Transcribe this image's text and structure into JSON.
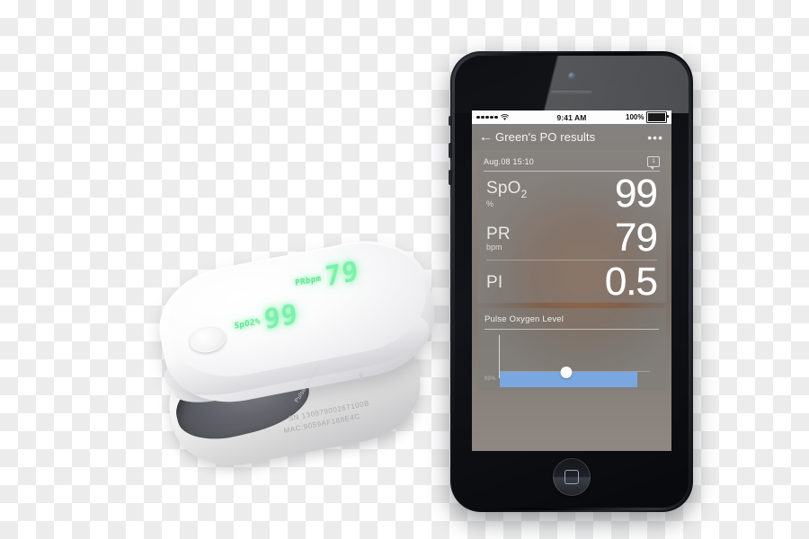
{
  "device": {
    "name": "pulse-oximeter",
    "led_display": {
      "spo2_label": "SpO2%",
      "spo2_value": "99",
      "pr_label": "PRbpm",
      "pr_value": "79"
    },
    "engraving": {
      "serial": "SN  13097900267100B",
      "mac": "MAC:9059AF188E4C",
      "fine_print": "Pulse Oximeter",
      "bluetooth_mark": "␢"
    }
  },
  "phone": {
    "status_bar": {
      "signal_dots": 5,
      "wifi_icon": "wifi-icon",
      "time": "9:41 AM",
      "battery_percent": "100%",
      "battery_icon": "battery-full-icon"
    },
    "nav_bar": {
      "back_icon": "←",
      "title": "Green's PO results",
      "more_icon": "•••"
    },
    "results_card": {
      "date": "Aug.08 15:10",
      "note_badge": "1",
      "note_icon": "note-bubble-icon",
      "metrics": [
        {
          "name": "SpO",
          "sub": "2",
          "unit": "%",
          "value": "99"
        },
        {
          "name": "PR",
          "sub": "",
          "unit": "bpm",
          "value": "79"
        },
        {
          "name": "PI",
          "sub": "",
          "unit": "",
          "value": "0.5"
        }
      ]
    },
    "chart_card": {
      "title": "Pulse Oxygen Level",
      "y_label": "99%"
    },
    "home_button": "home-button"
  },
  "chart_data": {
    "type": "bar",
    "title": "Pulse Oxygen Level",
    "categories": [
      "Aug.08 15:10"
    ],
    "values": [
      99
    ],
    "xlabel": "",
    "ylabel": "%",
    "ylim": [
      0,
      100
    ],
    "tick_labels": [
      "99%"
    ],
    "grid": false,
    "legend": "none",
    "series": [
      {
        "name": "SpO2",
        "values": [
          99
        ]
      }
    ],
    "annotations": [
      {
        "label": "selected-point",
        "value": 99,
        "x_fraction": 0.47
      }
    ],
    "colors": {
      "bar": "#7aa7e0",
      "marker": "#fbfbfb",
      "axis": "#f5f5f3"
    }
  },
  "colors": {
    "bar_blue": "#7aa7e0",
    "card_grey": "#83817e",
    "led_green": "#7ff0ab",
    "phone_black": "#15171b"
  }
}
